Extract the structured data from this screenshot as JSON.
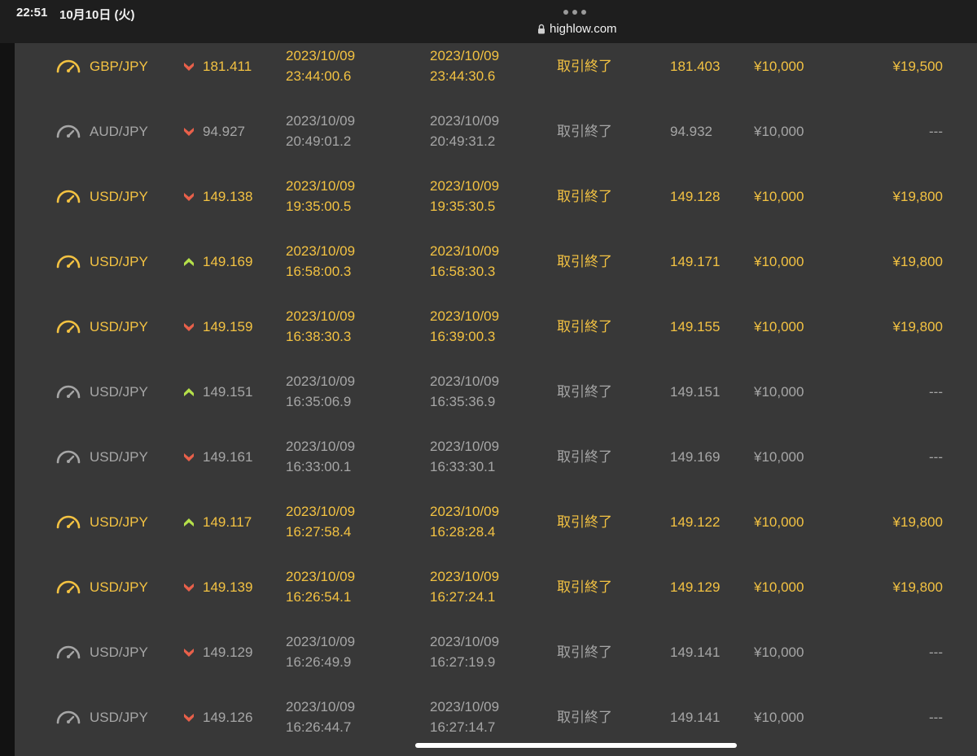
{
  "status_bar": {
    "time": "22:51",
    "date": "10月10日 (火)"
  },
  "browser": {
    "url": "highlow.com"
  },
  "colors": {
    "win": "#f3c242",
    "lose": "#a6a6a6",
    "down_arrow": "#e8604a",
    "up_arrow": "#b5e04a",
    "background": "#383838"
  },
  "trades": [
    {
      "result": "win",
      "asset": "GBP/JPY",
      "direction": "down",
      "strike": "181.411",
      "open_date": "2023/10/09",
      "open_time": "23:44:00.6",
      "expiry_date": "2023/10/09",
      "expiry_time": "23:44:30.6",
      "status": "取引終了",
      "closing_rate": "181.403",
      "amount": "¥10,000",
      "payout": "¥19,500"
    },
    {
      "result": "lose",
      "asset": "AUD/JPY",
      "direction": "down",
      "strike": "94.927",
      "open_date": "2023/10/09",
      "open_time": "20:49:01.2",
      "expiry_date": "2023/10/09",
      "expiry_time": "20:49:31.2",
      "status": "取引終了",
      "closing_rate": "94.932",
      "amount": "¥10,000",
      "payout": "---"
    },
    {
      "result": "win",
      "asset": "USD/JPY",
      "direction": "down",
      "strike": "149.138",
      "open_date": "2023/10/09",
      "open_time": "19:35:00.5",
      "expiry_date": "2023/10/09",
      "expiry_time": "19:35:30.5",
      "status": "取引終了",
      "closing_rate": "149.128",
      "amount": "¥10,000",
      "payout": "¥19,800"
    },
    {
      "result": "win",
      "asset": "USD/JPY",
      "direction": "up",
      "strike": "149.169",
      "open_date": "2023/10/09",
      "open_time": "16:58:00.3",
      "expiry_date": "2023/10/09",
      "expiry_time": "16:58:30.3",
      "status": "取引終了",
      "closing_rate": "149.171",
      "amount": "¥10,000",
      "payout": "¥19,800"
    },
    {
      "result": "win",
      "asset": "USD/JPY",
      "direction": "down",
      "strike": "149.159",
      "open_date": "2023/10/09",
      "open_time": "16:38:30.3",
      "expiry_date": "2023/10/09",
      "expiry_time": "16:39:00.3",
      "status": "取引終了",
      "closing_rate": "149.155",
      "amount": "¥10,000",
      "payout": "¥19,800"
    },
    {
      "result": "lose",
      "asset": "USD/JPY",
      "direction": "up",
      "strike": "149.151",
      "open_date": "2023/10/09",
      "open_time": "16:35:06.9",
      "expiry_date": "2023/10/09",
      "expiry_time": "16:35:36.9",
      "status": "取引終了",
      "closing_rate": "149.151",
      "amount": "¥10,000",
      "payout": "---"
    },
    {
      "result": "lose",
      "asset": "USD/JPY",
      "direction": "down",
      "strike": "149.161",
      "open_date": "2023/10/09",
      "open_time": "16:33:00.1",
      "expiry_date": "2023/10/09",
      "expiry_time": "16:33:30.1",
      "status": "取引終了",
      "closing_rate": "149.169",
      "amount": "¥10,000",
      "payout": "---"
    },
    {
      "result": "win",
      "asset": "USD/JPY",
      "direction": "up",
      "strike": "149.117",
      "open_date": "2023/10/09",
      "open_time": "16:27:58.4",
      "expiry_date": "2023/10/09",
      "expiry_time": "16:28:28.4",
      "status": "取引終了",
      "closing_rate": "149.122",
      "amount": "¥10,000",
      "payout": "¥19,800"
    },
    {
      "result": "win",
      "asset": "USD/JPY",
      "direction": "down",
      "strike": "149.139",
      "open_date": "2023/10/09",
      "open_time": "16:26:54.1",
      "expiry_date": "2023/10/09",
      "expiry_time": "16:27:24.1",
      "status": "取引終了",
      "closing_rate": "149.129",
      "amount": "¥10,000",
      "payout": "¥19,800"
    },
    {
      "result": "lose",
      "asset": "USD/JPY",
      "direction": "down",
      "strike": "149.129",
      "open_date": "2023/10/09",
      "open_time": "16:26:49.9",
      "expiry_date": "2023/10/09",
      "expiry_time": "16:27:19.9",
      "status": "取引終了",
      "closing_rate": "149.141",
      "amount": "¥10,000",
      "payout": "---"
    },
    {
      "result": "lose",
      "asset": "USD/JPY",
      "direction": "down",
      "strike": "149.126",
      "open_date": "2023/10/09",
      "open_time": "16:26:44.7",
      "expiry_date": "2023/10/09",
      "expiry_time": "16:27:14.7",
      "status": "取引終了",
      "closing_rate": "149.141",
      "amount": "¥10,000",
      "payout": "---"
    }
  ]
}
